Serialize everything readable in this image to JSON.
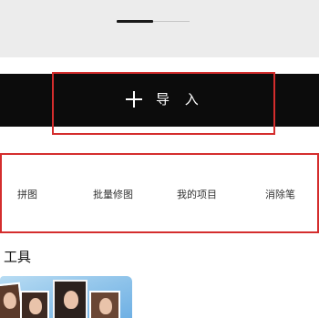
{
  "page_indicator": {
    "progress": 0.5
  },
  "import_button": {
    "icon": "plus-icon",
    "label": "导 入",
    "background": "#0c0c0c"
  },
  "highlight_color": "#d42d2d",
  "tools": [
    {
      "label": "拼图"
    },
    {
      "label": "批量修图"
    },
    {
      "label": "我的项目"
    },
    {
      "label": "消除笔"
    }
  ],
  "section": {
    "title": "工具"
  },
  "banner": {
    "description_icon": "portrait-thumbnails-image"
  }
}
